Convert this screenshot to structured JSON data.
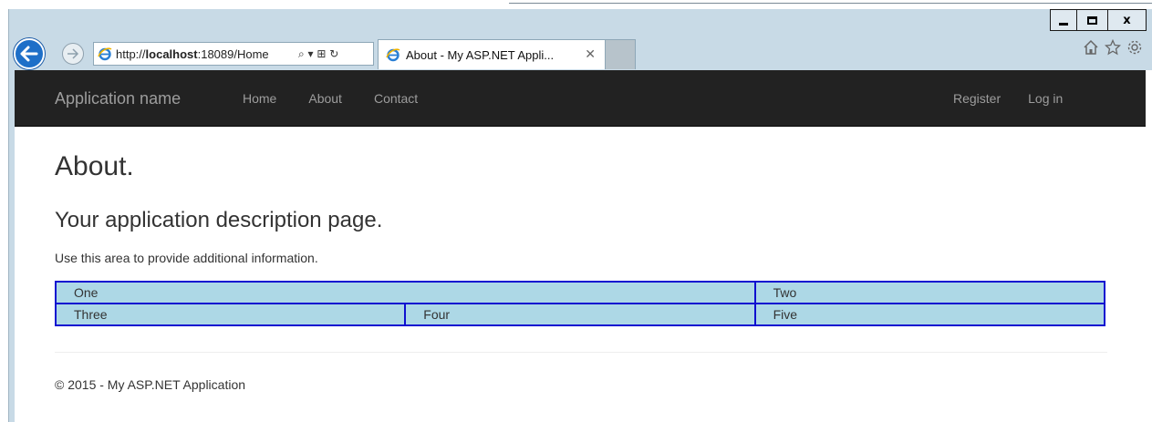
{
  "browser": {
    "address_url_host": "http://",
    "address_url_bold": "localhost",
    "address_url_rest": ":18089/Home",
    "address_tools": "⌕ ▾ ⊞ ↻",
    "tab_title": "About - My ASP.NET Appli...",
    "tab_close": "✕",
    "caption_close": "x",
    "toolbar_icons": [
      "home-icon",
      "favorites-star-icon",
      "settings-gear-icon"
    ]
  },
  "navbar": {
    "brand": "Application name",
    "links": [
      "Home",
      "About",
      "Contact"
    ],
    "right_links": [
      "Register",
      "Log in"
    ]
  },
  "main": {
    "title": "About.",
    "subtitle": "Your application description page.",
    "paragraph": "Use this area to provide additional information.",
    "grid": {
      "row1": [
        "One",
        "Two"
      ],
      "row2": [
        "Three",
        "Four",
        "Five"
      ]
    }
  },
  "footer": {
    "text": "© 2015 - My ASP.NET Application"
  },
  "colors": {
    "navbar_bg": "#222222",
    "navbar_text": "#9d9d9d",
    "cell_bg": "#add8e6",
    "cell_border": "#1010d0",
    "back_button": "#1e6fc8"
  }
}
